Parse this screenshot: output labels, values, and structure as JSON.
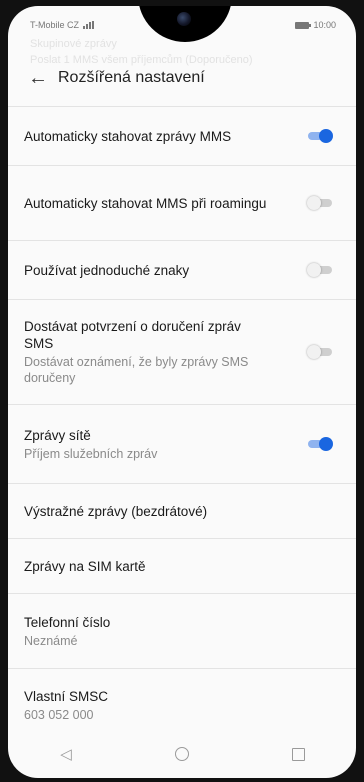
{
  "status_bar": {
    "carrier": "T-Mobile CZ",
    "time": "10:00"
  },
  "ghost_header": {
    "line1": "Skupinové zprávy",
    "line2": "Poslat 1 MMS všem příjemcům (Doporučeno)"
  },
  "header": {
    "title": "Rozšířená nastavení"
  },
  "settings": [
    {
      "title": "Automaticky stahovat zprávy MMS",
      "subtitle": "",
      "toggle": "on"
    },
    {
      "title": "Automaticky stahovat MMS při roamingu",
      "subtitle": "",
      "toggle": "off"
    },
    {
      "title": "Používat jednoduché znaky",
      "subtitle": "",
      "toggle": "off"
    },
    {
      "title": "Dostávat potvrzení o doručení zpráv SMS",
      "subtitle": "Dostávat oznámení, že byly zprávy SMS doručeny",
      "toggle": "off"
    },
    {
      "title": "Zprávy sítě",
      "subtitle": "Příjem služebních zpráv",
      "toggle": "on"
    },
    {
      "title": "Výstražné zprávy (bezdrátové)",
      "subtitle": "",
      "toggle": null
    },
    {
      "title": "Zprávy na SIM kartě",
      "subtitle": "",
      "toggle": null
    },
    {
      "title": "Telefonní číslo",
      "subtitle": "Neznámé",
      "toggle": null
    },
    {
      "title": "Vlastní SMSC",
      "subtitle": "603 052 000",
      "toggle": null
    }
  ],
  "icons": {
    "back": "arrow-left-icon",
    "nav": [
      "back-triangle-icon",
      "home-circle-icon",
      "recents-square-icon"
    ]
  },
  "colors": {
    "accent": "#1a66e0",
    "accent_track": "#8fb3ef",
    "off_track": "#cfcfcf",
    "background": "#fafafa"
  }
}
